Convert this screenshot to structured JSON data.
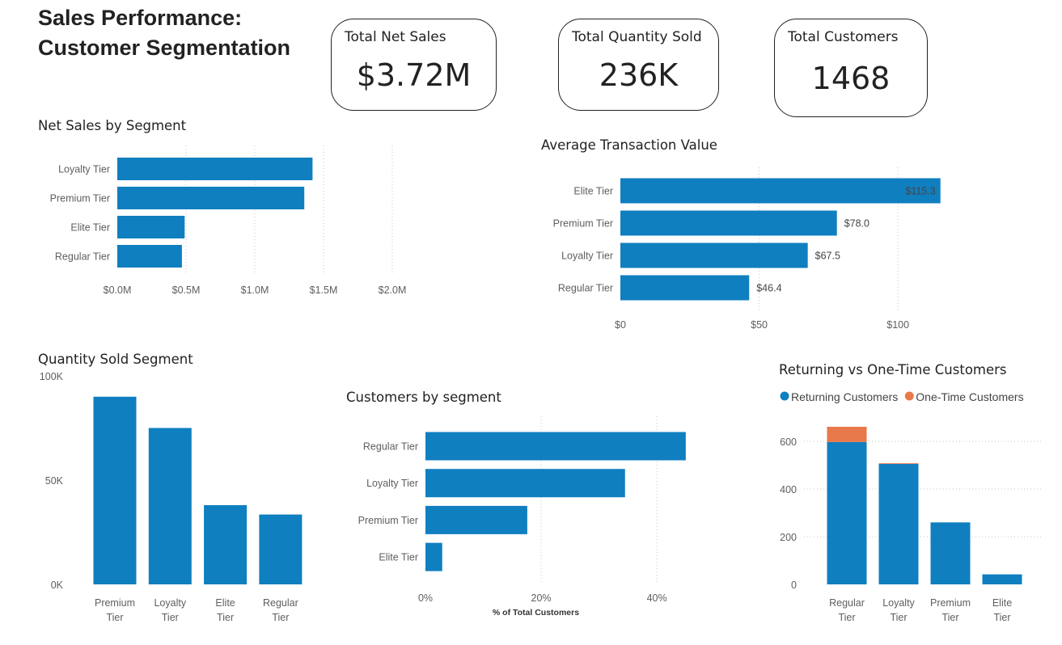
{
  "page": {
    "title": "Sales Performance: Customer Segmentation"
  },
  "colors": {
    "primary": "#0f7fc0",
    "secondary": "#e8794a",
    "grid": "#c8c6c4",
    "text": "#252423"
  },
  "kpis": {
    "net_sales": {
      "label": "Total Net Sales",
      "value": "$3.72M"
    },
    "quantity": {
      "label": "Total Quantity Sold",
      "value": "236K"
    },
    "customers": {
      "label": "Total Customers",
      "value": "1468"
    }
  },
  "chart_data": [
    {
      "id": "net_sales_by_segment",
      "type": "bar",
      "orientation": "horizontal",
      "title": "Net Sales by Segment",
      "categories": [
        "Loyalty Tier",
        "Premium Tier",
        "Elite Tier",
        "Regular Tier"
      ],
      "values": [
        1.42,
        1.36,
        0.49,
        0.47
      ],
      "xlim": [
        0,
        2
      ],
      "x_ticks": [
        0,
        0.5,
        1,
        1.5,
        2
      ],
      "x_tick_labels": [
        "$0.0M",
        "$0.5M",
        "$1.0M",
        "$1.5M",
        "$2.0M"
      ],
      "grid": true
    },
    {
      "id": "average_transaction_value",
      "type": "bar",
      "orientation": "horizontal",
      "title": "Average Transaction Value",
      "categories": [
        "Elite Tier",
        "Premium Tier",
        "Loyalty Tier",
        "Regular Tier"
      ],
      "values": [
        115.3,
        78.0,
        67.5,
        46.4
      ],
      "data_labels": [
        "$115.3",
        "$78.0",
        "$67.5",
        "$46.4"
      ],
      "xlim": [
        0,
        125
      ],
      "x_ticks": [
        0,
        50,
        100
      ],
      "x_tick_labels": [
        "$0",
        "$50",
        "$100"
      ],
      "grid": true
    },
    {
      "id": "quantity_sold_segment",
      "type": "bar",
      "orientation": "vertical",
      "title": "Quantity Sold Segment",
      "categories": [
        "Premium Tier",
        "Loyalty Tier",
        "Elite Tier",
        "Regular Tier"
      ],
      "values": [
        90000,
        75000,
        38000,
        33500
      ],
      "ylim": [
        0,
        100000
      ],
      "y_ticks": [
        0,
        50000,
        100000
      ],
      "y_tick_labels": [
        "0K",
        "50K",
        "100K"
      ],
      "grid": false
    },
    {
      "id": "customers_by_segment",
      "type": "bar",
      "orientation": "horizontal",
      "title": "Customers by segment",
      "xlabel": "% of Total Customers",
      "categories": [
        "Regular Tier",
        "Loyalty Tier",
        "Premium Tier",
        "Elite Tier"
      ],
      "values": [
        45,
        34.5,
        17.6,
        2.9
      ],
      "xlim": [
        0,
        46
      ],
      "x_ticks": [
        0,
        20,
        40
      ],
      "x_tick_labels": [
        "0%",
        "20%",
        "40%"
      ],
      "grid": true
    },
    {
      "id": "returning_vs_one_time",
      "type": "bar",
      "orientation": "vertical",
      "stacked": true,
      "title": "Returning vs One-Time Customers",
      "legend_position": "top-left",
      "categories": [
        "Regular Tier",
        "Loyalty Tier",
        "Premium Tier",
        "Elite Tier"
      ],
      "series": [
        {
          "name": "Returning Customers",
          "color": "#0f7fc0",
          "values": [
            597,
            505,
            260,
            42
          ]
        },
        {
          "name": "One-Time Customers",
          "color": "#e8794a",
          "values": [
            64,
            3,
            0,
            0
          ]
        }
      ],
      "ylim": [
        0,
        600
      ],
      "y_ticks": [
        0,
        200,
        400,
        600
      ],
      "y_tick_labels": [
        "0",
        "200",
        "400",
        "600"
      ],
      "grid": true
    }
  ]
}
